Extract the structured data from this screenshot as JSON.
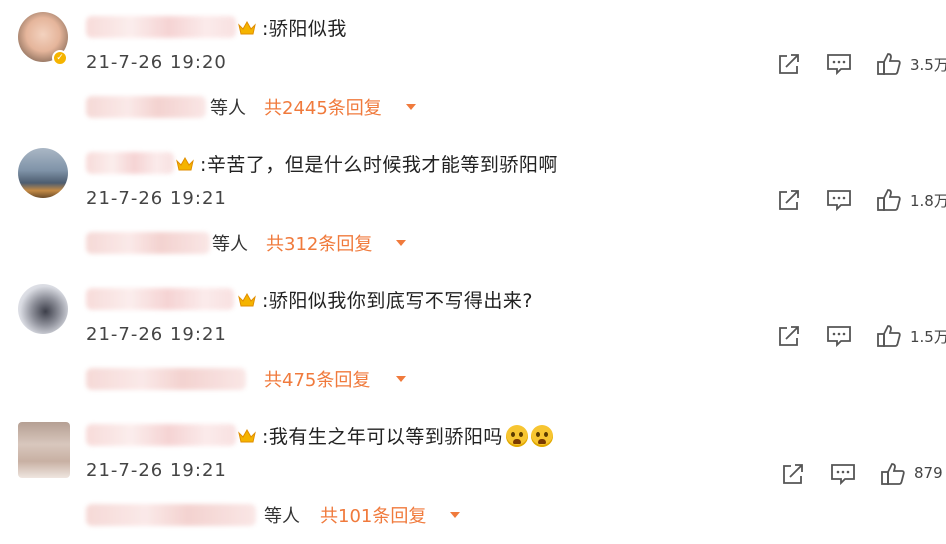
{
  "comments": [
    {
      "text": ":骄阳似我",
      "time": "21-7-26 19:20",
      "likes": "3.5万",
      "reply_people": "等人",
      "reply_total": "共2445条回复"
    },
    {
      "text": ":辛苦了，但是什么时候我才能等到骄阳啊",
      "time": "21-7-26 19:21",
      "likes": "1.8万",
      "reply_people": "等人",
      "reply_total": "共312条回复"
    },
    {
      "text": ":骄阳似我你到底写不写得出来?",
      "time": "21-7-26 19:21",
      "likes": "1.5万",
      "reply_people": "",
      "reply_total": "共475条回复"
    },
    {
      "text": ":我有生之年可以等到骄阳吗",
      "time": "21-7-26 19:21",
      "likes": "879",
      "reply_people": "等人",
      "reply_total": "共101条回复"
    }
  ],
  "icons": {
    "share": "share-icon",
    "comment": "comment-icon",
    "like": "thumbs-up-icon",
    "reply_expand": "caret-down-icon",
    "vip_crown": "crown-icon",
    "emoji": "crying-face-emoji"
  },
  "colors": {
    "accent": "#f07a3c",
    "badge": "#f5b400",
    "crown": "#f5b400"
  }
}
